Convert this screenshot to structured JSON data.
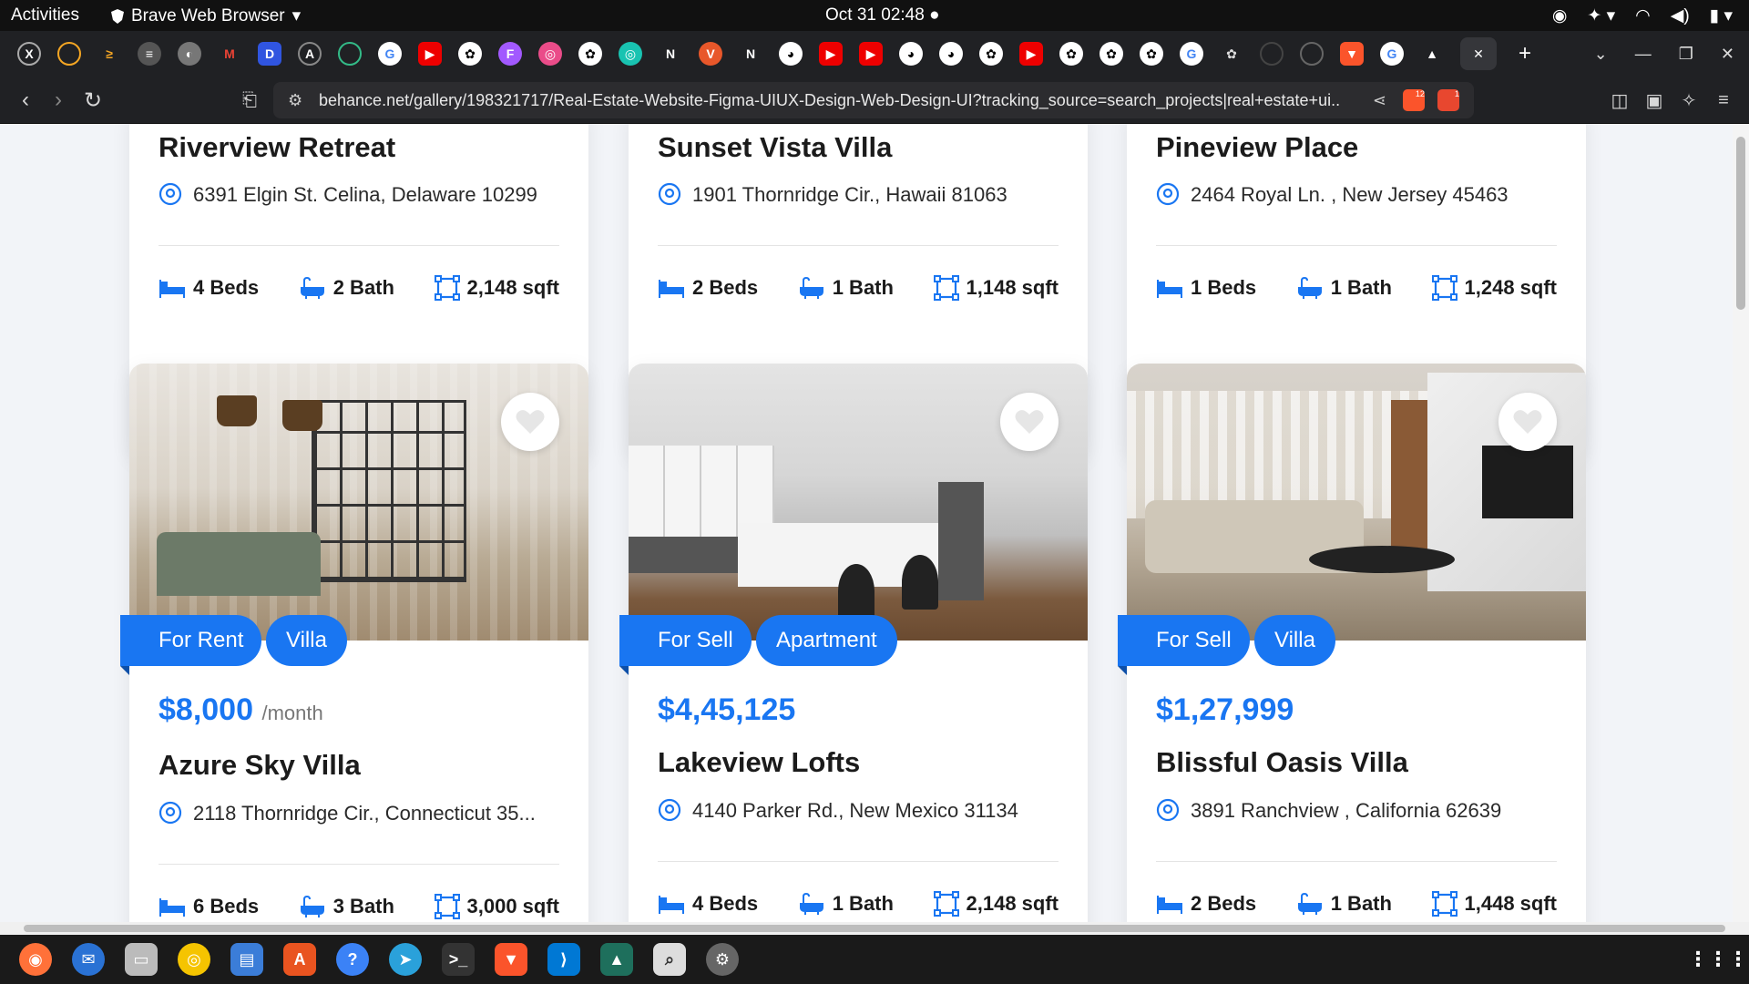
{
  "system_bar": {
    "activities": "Activities",
    "app_name": "Brave Web Browser",
    "clock": "Oct 31  02:48"
  },
  "browser": {
    "url": "behance.net/gallery/198321717/Real-Estate-Website-Figma-UIUX-Design-Web-Design-UI?tracking_source=search_projects|real+estate+ui...",
    "shields_badge": "12",
    "rewards_badge": "1",
    "tab_icons": [
      "x-icon",
      "coin-icon",
      "arrow-icon",
      "stack-icon",
      "globe-icon",
      "gmail-icon",
      "d-icon",
      "a-icon",
      "ai-icon",
      "google-icon",
      "youtube-icon",
      "openai-icon",
      "figma-icon",
      "dribbble-icon",
      "openai-icon",
      "circle-icon",
      "n-icon",
      "v-icon",
      "n-icon",
      "github-icon",
      "youtube-icon",
      "youtube-icon",
      "github-icon",
      "github-icon",
      "openai-icon",
      "youtube-icon",
      "openai-icon",
      "openai-icon",
      "openai-icon",
      "google-icon",
      "openai-icon",
      "circle-icon",
      "circle-icon",
      "brave-icon",
      "google-icon",
      "warning-icon"
    ],
    "tab_n": "N"
  },
  "listings_top": [
    {
      "title": "Riverview Retreat",
      "address": "6391 Elgin St. Celina, Delaware 10299",
      "beds": "4 Beds",
      "bath": "2 Bath",
      "sqft": "2,148 sqft"
    },
    {
      "title": "Sunset Vista Villa",
      "address": "1901 Thornridge Cir., Hawaii 81063",
      "beds": "2 Beds",
      "bath": "1 Bath",
      "sqft": "1,148 sqft"
    },
    {
      "title": "Pineview Place",
      "address": "2464 Royal Ln. , New Jersey 45463",
      "beds": "1 Beds",
      "bath": "1 Bath",
      "sqft": "1,248 sqft"
    }
  ],
  "listings_bottom": [
    {
      "tag1": "For Rent",
      "tag2": "Villa",
      "price": "$8,000",
      "price_suffix": "/month",
      "title": "Azure Sky Villa",
      "address": "2118 Thornridge Cir., Connecticut 35...",
      "beds": "6 Beds",
      "bath": "3 Bath",
      "sqft": "3,000 sqft"
    },
    {
      "tag1": "For Sell",
      "tag2": "Apartment",
      "price": "$4,45,125",
      "title": "Lakeview Lofts",
      "address": "4140 Parker Rd., New Mexico 31134",
      "beds": "4 Beds",
      "bath": "1 Bath",
      "sqft": "2,148 sqft"
    },
    {
      "tag1": "For Sell",
      "tag2": "Villa",
      "price": "$1,27,999",
      "title": "Blissful Oasis Villa",
      "address": "3891 Ranchview , California 62639",
      "beds": "2 Beds",
      "bath": "1 Bath",
      "sqft": "1,448 sqft"
    }
  ],
  "colors": {
    "accent": "#1976f2",
    "browser_chrome": "#202124"
  }
}
